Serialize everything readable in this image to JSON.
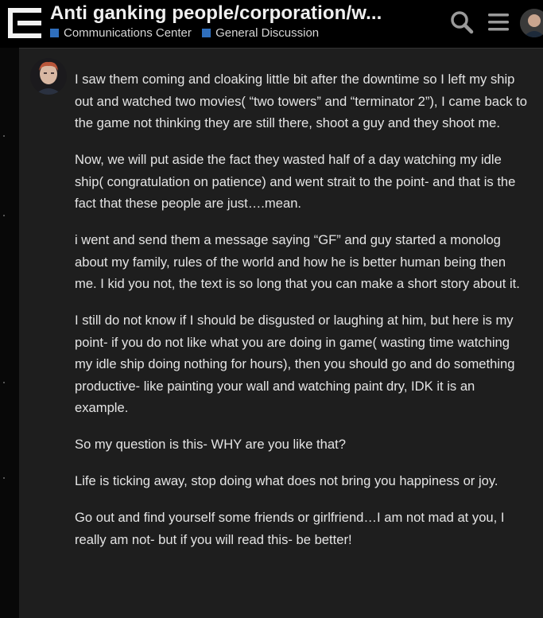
{
  "header": {
    "title": "Anti ganking people/corporation/w...",
    "categories": [
      {
        "label": "Communications Center",
        "color": "#2f6fbd"
      },
      {
        "label": "General Discussion",
        "color": "#2f6fbd"
      }
    ],
    "icons": {
      "logo": "site-logo",
      "search": "search-icon",
      "menu": "hamburger-menu-icon",
      "user": "user-avatar"
    }
  },
  "post": {
    "paragraphs": [
      "I saw them coming and cloaking little bit after the downtime so I left my ship out and watched two movies( “two towers” and “terminator 2”), I came back to the game not thinking they are still there, shoot a guy and they shoot me.",
      "Now, we will put aside the fact they wasted half of a day watching my idle ship( congratulation on patience) and went strait to the point- and that is the fact that these people are just….mean.",
      "i went and send them a message saying “GF” and guy started a monolog about my family, rules of the world and how he is better human being then me. I kid you not, the text is so long that you can make a short story about it.",
      "I still do not know if I should be disgusted or laughing at him, but here is my point- if you do not like what you are doing in game( wasting time watching my idle ship doing nothing for hours), then you should go and do something productive- like painting your wall and watching paint dry, IDK it is an example.",
      "So my question is this- WHY are you like that?",
      "Life is ticking away, stop doing what does not bring you happiness or joy.",
      "Go out and find yourself some friends or girlfriend…I am not mad at you, I really am not- but if you will read this- be better!"
    ]
  }
}
